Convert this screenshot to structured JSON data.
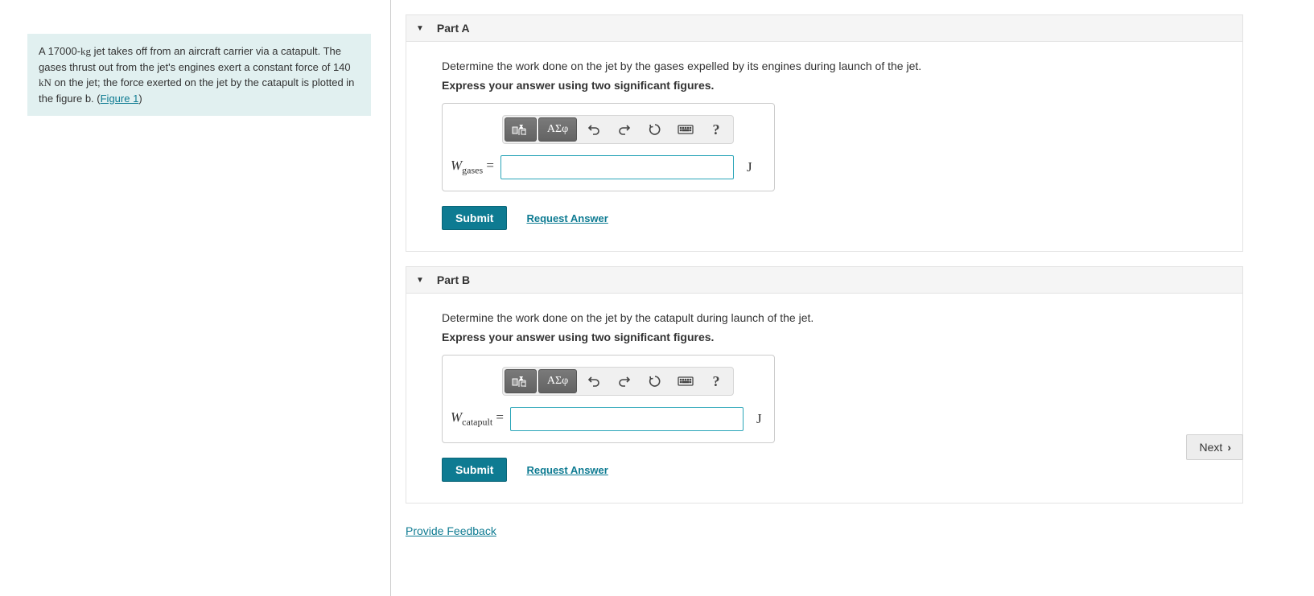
{
  "problem": {
    "text_part1": "A 17000-",
    "unit_kg": "kg",
    "text_part2": " jet takes off from an aircraft carrier via a catapult. The gases thrust out from the jet's engines exert a constant force of 140 ",
    "unit_kN": "kN",
    "text_part3": " on the jet; the force exerted on the jet by the catapult is plotted in the figure b. (",
    "figure_link": "Figure 1",
    "text_part4": ")"
  },
  "partA": {
    "title": "Part A",
    "prompt": "Determine the work done on the jet by the gases expelled by its engines during launch of the jet.",
    "instructions": "Express your answer using two significant figures.",
    "var_letter": "W",
    "var_sub": "gases",
    "equals": " = ",
    "unit": "J",
    "submit": "Submit",
    "request": "Request Answer",
    "greek_label": "ΑΣφ",
    "help_label": "?"
  },
  "partB": {
    "title": "Part B",
    "prompt": "Determine the work done on the jet by the catapult during launch of the jet.",
    "instructions": "Express your answer using two significant figures.",
    "var_letter": "W",
    "var_sub": "catapult",
    "equals": " = ",
    "unit": "J",
    "submit": "Submit",
    "request": "Request Answer",
    "greek_label": "ΑΣφ",
    "help_label": "?"
  },
  "footer": {
    "feedback": "Provide Feedback",
    "next": "Next"
  }
}
